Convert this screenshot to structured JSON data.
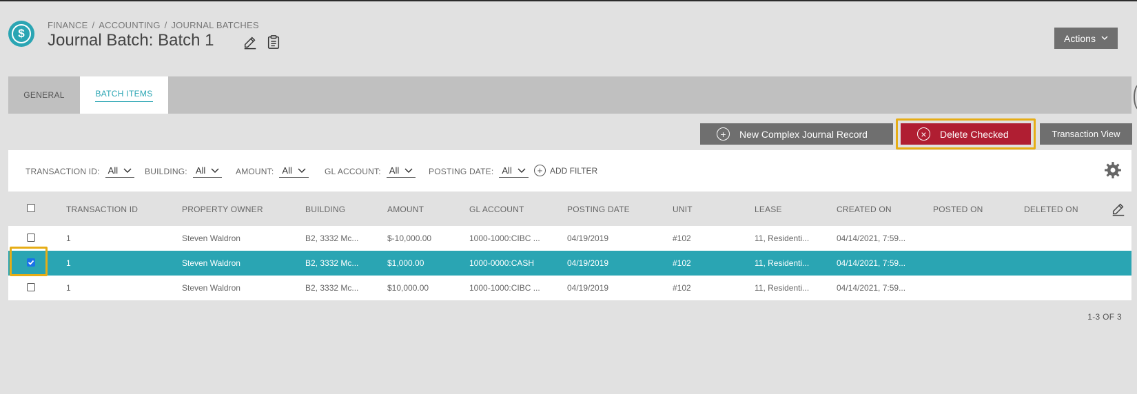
{
  "header": {
    "breadcrumb": [
      "FINANCE",
      "ACCOUNTING",
      "JOURNAL BATCHES"
    ],
    "breadcrumb_sep": "/",
    "title": "Journal Batch: Batch 1",
    "actions_label": "Actions",
    "app_icon_symbol": "$"
  },
  "tabs": [
    {
      "label": "GENERAL",
      "active": false
    },
    {
      "label": "BATCH ITEMS",
      "active": true
    }
  ],
  "toolbar": {
    "new_label": "New Complex Journal Record",
    "delete_label": "Delete Checked",
    "transaction_view_label": "Transaction View"
  },
  "filters": [
    {
      "label": "TRANSACTION ID:",
      "value": "All"
    },
    {
      "label": "BUILDING:",
      "value": "All"
    },
    {
      "label": "AMOUNT:",
      "value": "All"
    },
    {
      "label": "GL ACCOUNT:",
      "value": "All"
    },
    {
      "label": "POSTING DATE:",
      "value": "All"
    }
  ],
  "add_filter_label": "ADD FILTER",
  "table": {
    "columns": [
      "TRANSACTION ID",
      "PROPERTY OWNER",
      "BUILDING",
      "AMOUNT",
      "GL ACCOUNT",
      "POSTING DATE",
      "UNIT",
      "LEASE",
      "CREATED ON",
      "POSTED ON",
      "DELETED ON"
    ],
    "rows": [
      {
        "checked": false,
        "cells": [
          "1",
          "Steven Waldron",
          "B2, 3332 Mc...",
          "$-10,000.00",
          "1000-1000:CIBC ...",
          "04/19/2019",
          "#102",
          "11, Residenti...",
          "04/14/2021, 7:59...",
          "",
          ""
        ]
      },
      {
        "checked": true,
        "cells": [
          "1",
          "Steven Waldron",
          "B2, 3332 Mc...",
          "$1,000.00",
          "1000-0000:CASH",
          "04/19/2019",
          "#102",
          "11, Residenti...",
          "04/14/2021, 7:59...",
          "",
          ""
        ]
      },
      {
        "checked": false,
        "cells": [
          "1",
          "Steven Waldron",
          "B2, 3332 Mc...",
          "$10,000.00",
          "1000-1000:CIBC ...",
          "04/19/2019",
          "#102",
          "11, Residenti...",
          "04/14/2021, 7:59...",
          "",
          ""
        ]
      }
    ]
  },
  "pagination": "1-3 OF 3",
  "colors": {
    "accent": "#2aa5b3",
    "danger": "#b01e32",
    "highlight": "#e6ad16",
    "button_gray": "#6f6f6f"
  }
}
